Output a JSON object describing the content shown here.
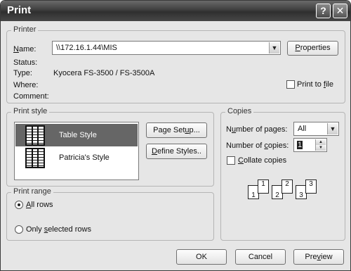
{
  "window": {
    "title": "Print",
    "help_glyph": "?",
    "close_glyph": "✕"
  },
  "printer": {
    "legend": "Printer",
    "name_label": "Name:",
    "name_value": "\\\\172.16.1.44\\MIS",
    "properties_label": "Properties",
    "status_label": "Status:",
    "type_label": "Type:",
    "type_value": "Kyocera FS-3500 / FS-3500A",
    "where_label": "Where:",
    "comment_label": "Comment:",
    "print_to_file_label": "Print to file",
    "print_to_file_checked": false
  },
  "print_style": {
    "legend": "Print style",
    "items": [
      {
        "name": "Table Style",
        "selected": true
      },
      {
        "name": "Patricia's Style",
        "selected": false
      }
    ],
    "page_setup_label": "Page Setup...",
    "define_styles_label": "Define Styles.."
  },
  "copies": {
    "legend": "Copies",
    "num_pages_label": "Number of pages:",
    "num_pages_value": "All",
    "num_copies_label": "Number of copies:",
    "num_copies_value": "1",
    "collate_label": "Collate copies",
    "collate_checked": false,
    "collate_sets": [
      [
        "1",
        "1"
      ],
      [
        "2",
        "2"
      ],
      [
        "3",
        "3"
      ]
    ]
  },
  "print_range": {
    "legend": "Print range",
    "all_rows_label": "All rows",
    "all_rows_selected": true,
    "selected_rows_label": "Only selected rows",
    "selected_rows_selected": false
  },
  "footer": {
    "ok_label": "OK",
    "cancel_label": "Cancel",
    "preview_label": "Preview"
  },
  "icons": {
    "dropdown_arrow": "▼",
    "spin_up": "▲",
    "spin_down": "▼"
  }
}
